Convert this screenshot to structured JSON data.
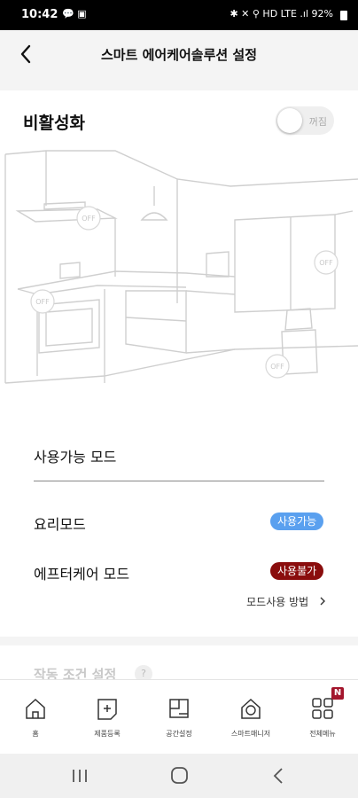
{
  "status_bar": {
    "time": "10:42",
    "notif_glyphs": "💬 ▣",
    "right_text": "✱ ✕ ⚲ HD LTE .ıl",
    "battery": "92%"
  },
  "header": {
    "title": "스마트 에어케어솔루션 설정"
  },
  "activation": {
    "title": "비활성화",
    "toggle_label": "꺼짐"
  },
  "illustration": {
    "off_label": "OFF"
  },
  "modes": {
    "header": "사용가능 모드",
    "items": [
      {
        "label": "요리모드",
        "badge": "사용가능",
        "badge_color": "#5aa0ef"
      },
      {
        "label": "에프터케어 모드",
        "badge": "사용불가",
        "badge_color": "#8a0d0d"
      }
    ],
    "guide": "모드사용 방법"
  },
  "next_section": {
    "label": "작동 조건 설정",
    "help": "?"
  },
  "tabs": [
    {
      "label": "홈",
      "icon": "home-icon"
    },
    {
      "label": "제품등록",
      "icon": "product-register-icon"
    },
    {
      "label": "공간설정",
      "icon": "space-settings-icon"
    },
    {
      "label": "스마트매니저",
      "icon": "smart-manager-icon"
    },
    {
      "label": "전체메뉴",
      "icon": "grid-menu-icon",
      "badge": "N"
    }
  ],
  "colors": {
    "accent_red": "#a3152c",
    "badge_blue": "#5aa0ef",
    "badge_dark_red": "#8a0d0d"
  }
}
